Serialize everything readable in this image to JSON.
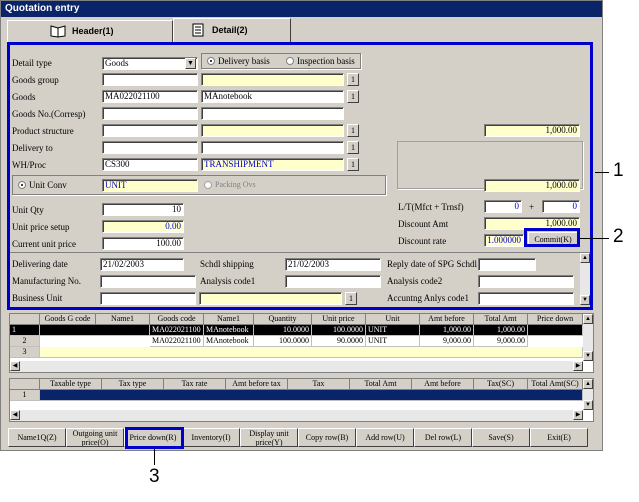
{
  "window": {
    "title": "Quotation entry"
  },
  "tabs": [
    {
      "label": "Header(1)"
    },
    {
      "label": "Detail(2)"
    }
  ],
  "detail": {
    "detail_type_label": "Detail type",
    "detail_type_value": "Goods",
    "delivery_basis": "Delivery basis",
    "inspection_basis": "Inspection basis",
    "goods_group_label": "Goods group",
    "goods_label": "Goods",
    "goods_code": "MA022021100",
    "goods_name": "MAnotebook",
    "goods_no_label": "Goods No.(Corresp)",
    "product_structure_label": "Product structure",
    "delivery_to_label": "Delivery to",
    "wh_proc_label": "WH/Proc",
    "wh_proc_code": "CS300",
    "wh_proc_name": "TRANSHIPMENT",
    "unit_conv_label": "Unit Conv",
    "unit_value": "UNIT",
    "packing_ovs_label": "Packing Ovs",
    "unit_qty_label": "Unit Qty",
    "unit_qty_value": "10",
    "unit_price_setup_label": "Unit price setup",
    "unit_price_setup_value": "0.00",
    "current_unit_price_label": "Current unit price",
    "current_unit_price_value": "100.00",
    "amt_top": "1,000.00",
    "amt_mid": "1,000.00",
    "lt_label": "L/T(Mfct + Trnsf)",
    "lt_value1": "0",
    "lt_plus": "+",
    "lt_value2": "0",
    "discount_amt_label": "Discount Amt",
    "discount_amt_value": "1,000.00",
    "discount_rate_label": "Discount rate",
    "discount_rate_value": "1.000000",
    "commit_label": "Commit(K)",
    "delivering_date_label": "Delivering date",
    "delivering_date_value": "21/02/2003",
    "schdl_shipping_label": "Schdl shipping",
    "schdl_shipping_value": "21/02/2003",
    "reply_date_label": "Reply date of SPG Schdl",
    "manufacturing_no_label": "Manufacturing No.",
    "analysis_code1_label": "Analysis code1",
    "analysis_code2_label": "Analysis code2",
    "business_unit_label": "Business Unit",
    "accnting_anlys_label": "Accuntng Anlys code1",
    "small_btn": "1"
  },
  "grid1": {
    "headers": [
      "Goods G code",
      "Name1",
      "Goods code",
      "Name1",
      "Quantity",
      "Unit price",
      "Unit",
      "Amt before",
      "Total Amt",
      "Price down"
    ],
    "rows": [
      {
        "no": "1",
        "goods_code": "MA022021100",
        "name": "MAnotebook",
        "qty": "10.0000",
        "price": "100.0000",
        "unit": "UNIT",
        "amt": "1,000.00",
        "total": "1,000.00"
      },
      {
        "no": "2",
        "goods_code": "MA022021100",
        "name": "MAnotebook",
        "qty": "100.0000",
        "price": "90.0000",
        "unit": "UNIT",
        "amt": "9,000.00",
        "total": "9,000.00"
      },
      {
        "no": "3",
        "goods_code": "",
        "name": "",
        "qty": "",
        "price": "",
        "unit": "",
        "amt": "",
        "total": ""
      }
    ]
  },
  "grid2": {
    "headers": [
      "Taxable type",
      "Tax type",
      "Tax rate",
      "Amt before tax",
      "Tax",
      "Total Amt",
      "Amt before",
      "Tax(SC)",
      "Total Amt(SC)"
    ],
    "rows": [
      {
        "no": "1"
      }
    ]
  },
  "toolbar": [
    {
      "label": "Name1Q(Z)"
    },
    {
      "label": "Outgoing unit price(O)"
    },
    {
      "label": "Price down(R)"
    },
    {
      "label": "Inventory(I)"
    },
    {
      "label": "Display unit price(Y)"
    },
    {
      "label": "Copy row(B)"
    },
    {
      "label": "Add row(U)"
    },
    {
      "label": "Del row(L)"
    },
    {
      "label": "Save(S)"
    },
    {
      "label": "Exit(E)"
    }
  ],
  "callouts": [
    "1",
    "2",
    "3"
  ]
}
